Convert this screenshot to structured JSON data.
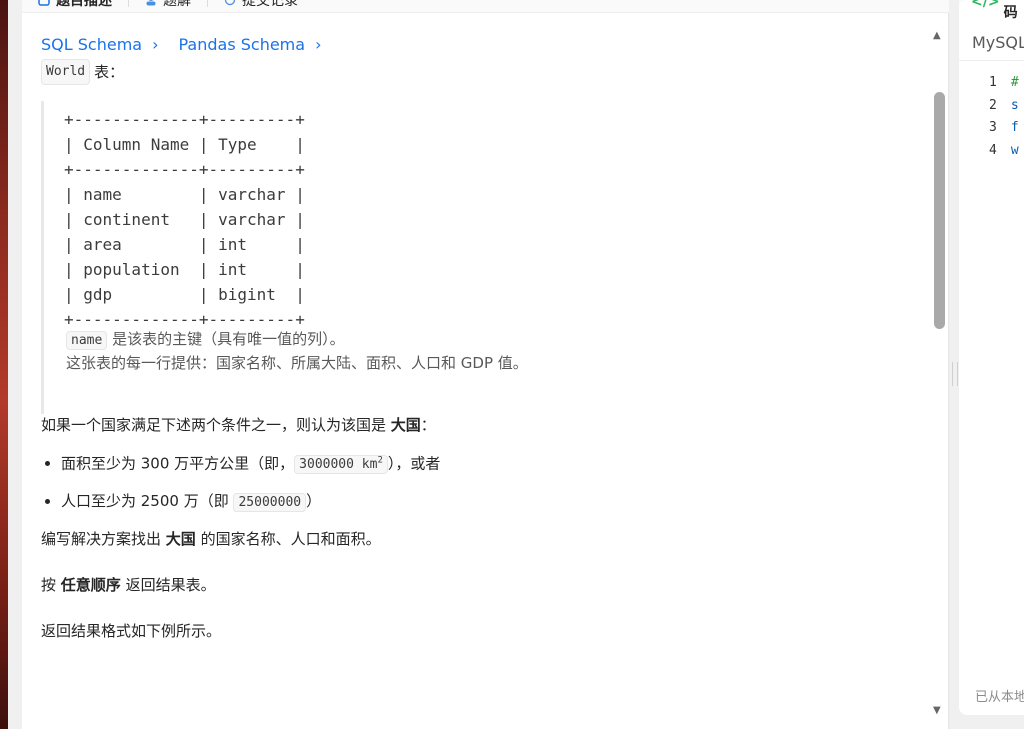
{
  "tabs": [
    {
      "label": "题目描述",
      "icon": "document-icon"
    },
    {
      "label": "题解",
      "icon": "flask-icon"
    },
    {
      "label": "提交记录",
      "icon": "history-icon"
    }
  ],
  "schema_links": [
    "SQL Schema",
    "Pandas Schema"
  ],
  "table_name": "World",
  "table_suffix": "表：",
  "schema_block": "+-------------+---------+\n| Column Name | Type    |\n+-------------+---------+\n| name        | varchar |\n| continent   | varchar |\n| area        | int     |\n| population  | int     |\n| gdp         | bigint  |\n+-------------+---------+",
  "key_code": "name",
  "key_note": "是该表的主键（具有唯一值的列）。",
  "row_note": "这张表的每一行提供：国家名称、所属大陆、面积、人口和 GDP 值。",
  "big_intro_pre": "如果一个国家满足下述两个条件之一，则认为该国是 ",
  "big_word": "大国",
  "big_intro_post": "：",
  "cond1_pre": "面积至少为 300 万平方公里（即，",
  "cond1_code": "3000000 km",
  "cond1_sup": "2",
  "cond1_post": "），或者",
  "cond2_pre": "人口至少为 2500 万（即 ",
  "cond2_code": "25000000",
  "cond2_post": "）",
  "task_pre": "编写解决方案找出 ",
  "task_bold": "大国",
  "task_post": " 的国家名称、人口和面积。",
  "order_pre": "按 ",
  "order_bold": "任意顺序",
  "order_post": " 返回结果表。",
  "format_note": "返回结果格式如下例所示。",
  "code_panel": {
    "title": "代码",
    "language": "MySQL",
    "line_numbers": [
      "1",
      "2",
      "3",
      "4"
    ],
    "line_starts": [
      "#",
      "s",
      "f",
      "w"
    ],
    "saved_text": "已从本地"
  }
}
